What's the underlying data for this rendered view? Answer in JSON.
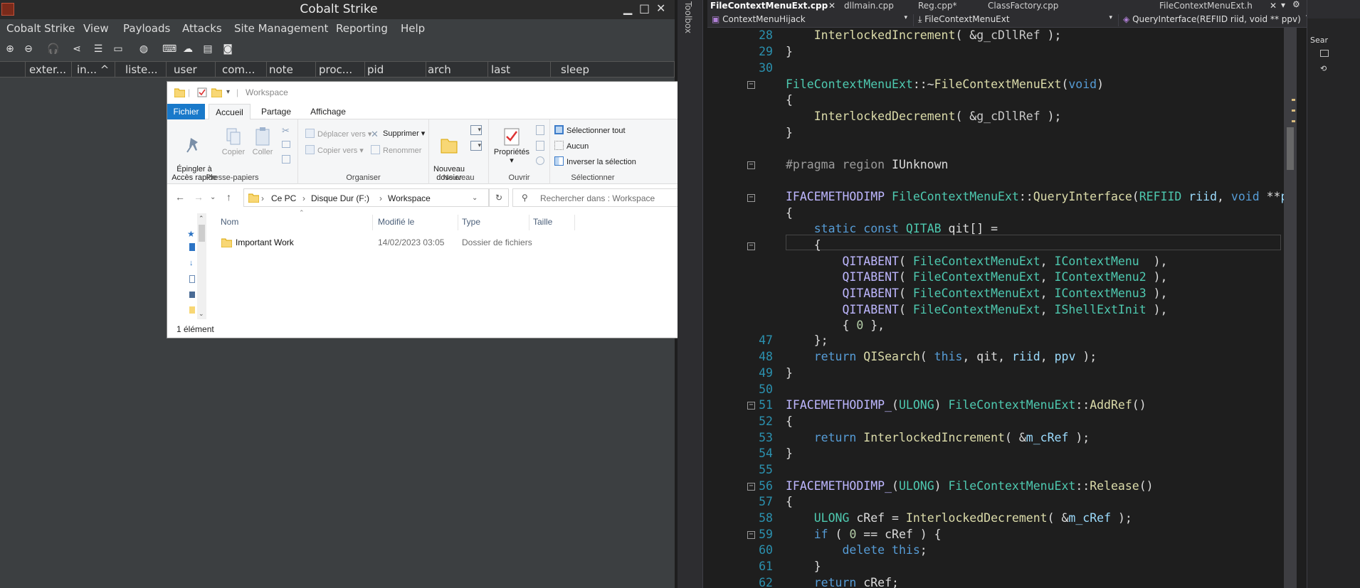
{
  "cobalt": {
    "title": "Cobalt Strike",
    "menu": [
      "Cobalt Strike",
      "View",
      "Payloads",
      "Attacks",
      "Site Management",
      "Reporting",
      "Help"
    ],
    "columns": [
      "exter...",
      "in... ^",
      "liste...",
      "user",
      "com...",
      "note",
      "proc...",
      "pid",
      "arch",
      "last",
      "sleep"
    ]
  },
  "explorer": {
    "title": "Workspace",
    "tabs": [
      "Fichier",
      "Accueil",
      "Partage",
      "Affichage"
    ],
    "ribbon": {
      "presse": {
        "label": "Presse-papiers",
        "pin": "Épingler à\nAccès rapide",
        "copy": "Copier",
        "paste": "Coller"
      },
      "organiser": {
        "label": "Organiser",
        "move": "Déplacer vers",
        "copyto": "Copier vers",
        "delete": "Supprimer",
        "rename": "Renommer"
      },
      "nouveau": {
        "label": "Nouveau",
        "newfolder": "Nouveau\ndossier"
      },
      "ouvrir": {
        "label": "Ouvrir",
        "props": "Propriétés"
      },
      "selection": {
        "label": "Sélectionner",
        "all": "Sélectionner tout",
        "none": "Aucun",
        "invert": "Inverser la sélection"
      }
    },
    "breadcrumb": [
      "Ce PC",
      "Disque Dur (F:)",
      "Workspace"
    ],
    "search_placeholder": "Rechercher dans : Workspace",
    "headers": [
      "Nom",
      "Modifié le",
      "Type",
      "Taille"
    ],
    "rows": [
      {
        "name": "Important Work",
        "modified": "14/02/2023 03:05",
        "type": "Dossier de fichiers",
        "size": ""
      }
    ],
    "status": "1 élément"
  },
  "vs": {
    "tabs": [
      "FileContextMenuExt.cpp",
      "dllmain.cpp",
      "Reg.cpp*",
      "ClassFactory.cpp",
      "FileContextMenuExt.h"
    ],
    "nav": [
      "ContextMenuHijack",
      "FileContextMenuExt",
      "QueryInterface(REFIID riid, void ** ppv)"
    ],
    "toolbox_label": "Toolbox",
    "search_label": "Sear",
    "line_numbers": [
      "28",
      "29",
      "30",
      "",
      "",
      "",
      "",
      "",
      "",
      "",
      "",
      "",
      "",
      "47",
      "48",
      "49",
      "50",
      "51",
      "52",
      "53",
      "54",
      "55",
      "56",
      "57",
      "58",
      "59",
      "60",
      "61",
      "62"
    ]
  }
}
